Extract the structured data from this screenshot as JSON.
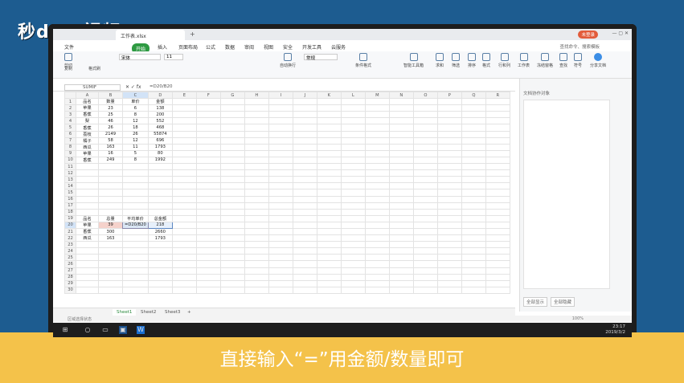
{
  "overlay": {
    "logo": "秒d ng视频",
    "caption": "直接输入“=”用金额/数量即可"
  },
  "app": {
    "doc_tab": "工作表.xlsx",
    "login_btn": "未登录",
    "menu": [
      "文件",
      "开始",
      "插入",
      "页面布局",
      "公式",
      "数据",
      "审阅",
      "视图",
      "安全",
      "开发工具",
      "云服务"
    ],
    "search_hint": "查找命令、搜索模板",
    "ribbon": [
      {
        "label": "剪切"
      },
      {
        "label": "复制"
      },
      {
        "label": "格式刷"
      },
      {
        "label": "自动换行"
      },
      {
        "label": "条件格式"
      },
      {
        "label": "智能工具箱"
      },
      {
        "label": "求和"
      },
      {
        "label": "筛选"
      },
      {
        "label": "排序"
      },
      {
        "label": "格式"
      },
      {
        "label": "行和列"
      },
      {
        "label": "工作表"
      },
      {
        "label": "冻结窗格"
      },
      {
        "label": "查找"
      },
      {
        "label": "符号"
      },
      {
        "label": "分享文档"
      }
    ],
    "font_name": "宋体",
    "font_size": "11",
    "number_format": "常规",
    "formula_bar": {
      "name_box": "SUMIF",
      "fx": "fx",
      "formula": "=D20/B20"
    },
    "columns": [
      "A",
      "B",
      "C",
      "D",
      "E",
      "F",
      "G",
      "H",
      "I",
      "J",
      "K",
      "L",
      "M",
      "N",
      "O",
      "P",
      "Q",
      "R"
    ],
    "rows": [
      [
        "品名",
        "数量",
        "单价",
        "金额"
      ],
      [
        "苹果",
        "23",
        "6",
        "138"
      ],
      [
        "香蕉",
        "25",
        "8",
        "200"
      ],
      [
        "梨",
        "46",
        "12",
        "552"
      ],
      [
        "香蕉",
        "26",
        "18",
        "468"
      ],
      [
        "荔枝",
        "2149",
        "26",
        "55874"
      ],
      [
        "橘子",
        "58",
        "12",
        "696"
      ],
      [
        "西瓜",
        "163",
        "11",
        "1793"
      ],
      [
        "苹果",
        "16",
        "5",
        "80"
      ],
      [
        "香蕉",
        "249",
        "8",
        "1992"
      ],
      [
        "",
        "",
        "",
        ""
      ],
      [
        "",
        "",
        "",
        ""
      ],
      [
        "",
        "",
        "",
        ""
      ],
      [
        "",
        "",
        "",
        ""
      ],
      [
        "",
        "",
        "",
        ""
      ],
      [
        "",
        "",
        "",
        ""
      ],
      [
        "",
        "",
        "",
        ""
      ],
      [
        "",
        "",
        "",
        ""
      ],
      [
        "品名",
        "总量",
        "平均单价",
        "总金额"
      ],
      [
        "苹果",
        "39",
        "=D20/B20",
        "218"
      ],
      [
        "香蕉",
        "300",
        "",
        "2660"
      ],
      [
        "西瓜",
        "163",
        "",
        "1793"
      ],
      [
        "",
        "",
        "",
        ""
      ],
      [
        "",
        "",
        "",
        ""
      ],
      [
        "",
        "",
        "",
        ""
      ],
      [
        "",
        "",
        "",
        ""
      ],
      [
        "",
        "",
        "",
        ""
      ],
      [
        "",
        "",
        "",
        ""
      ],
      [
        "",
        "",
        "",
        ""
      ],
      [
        "",
        "",
        "",
        ""
      ]
    ],
    "sheets": [
      "Sheet1",
      "Sheet2",
      "Sheet3",
      "+"
    ],
    "status_left": "区域选择状态",
    "right_pane": {
      "title": "文档协作对象",
      "btn1": "全部显示",
      "btn2": "全部隐藏"
    },
    "zoom": "100%",
    "clock": {
      "time": "23:17",
      "date": "2019/3/2"
    }
  }
}
